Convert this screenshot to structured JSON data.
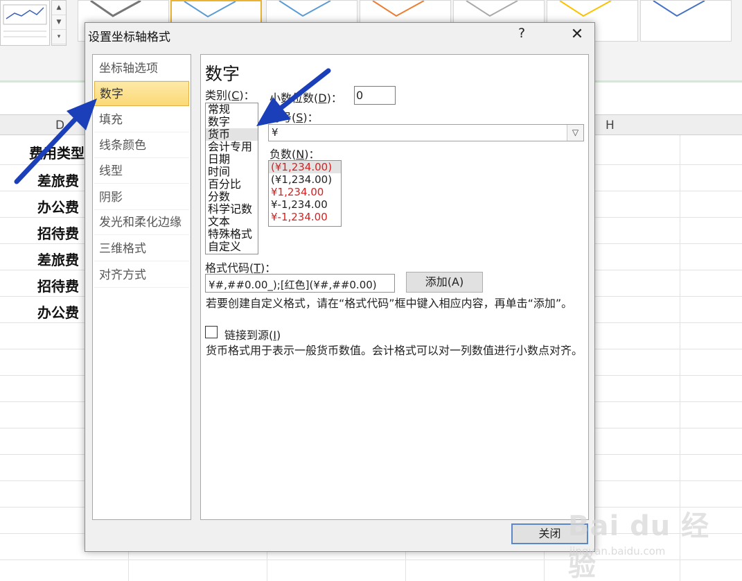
{
  "background": {
    "col_letters": [
      "D",
      "H"
    ],
    "cells": [
      "费用类型",
      "差旅费",
      "办公费",
      "招待费",
      "差旅费",
      "招待费",
      "办公费"
    ]
  },
  "dialog": {
    "title": "设置坐标轴格式",
    "help_glyph": "?",
    "close_glyph": "✕",
    "nav": [
      "坐标轴选项",
      "数字",
      "填充",
      "线条颜色",
      "线型",
      "阴影",
      "发光和柔化边缘",
      "三维格式",
      "对齐方式"
    ],
    "nav_selected": "数字",
    "panel_title": "数字",
    "category_label": "类别(",
    "category_key": "C",
    "category_suffix": ")：",
    "categories": [
      "常规",
      "数字",
      "货币",
      "会计专用",
      "日期",
      "时间",
      "百分比",
      "分数",
      "科学记数",
      "文本",
      "特殊格式",
      "自定义"
    ],
    "category_selected": "货币",
    "decimal_label": "小数位数(",
    "decimal_key": "D",
    "decimal_suffix": ")：",
    "decimal_value": "0",
    "symbol_label": "符号(",
    "symbol_key": "S",
    "symbol_suffix": ")：",
    "symbol_value": "¥",
    "negative_label": "负数(",
    "negative_key": "N",
    "negative_suffix": ")：",
    "negatives": [
      "(¥1,234.00)",
      "(¥1,234.00)",
      "¥1,234.00",
      "¥-1,234.00",
      "¥-1,234.00"
    ],
    "format_code_label": "格式代码(",
    "format_code_key": "T",
    "format_code_suffix": ")：",
    "format_code_value": "¥#,##0.00_);[红色](¥#,##0.00)",
    "add_button": "添加(A)",
    "hint": "若要创建自定义格式，请在“格式代码”框中键入相应内容，再单击“添加”。",
    "link_label": "链接到源(",
    "link_key": "I",
    "link_suffix": ")",
    "description": "货币格式用于表示一般货币数值。会计格式可以对一列数值进行小数点对齐。",
    "close_button": "关闭"
  },
  "watermark": {
    "text": "Bai du 经验",
    "url": "jingyan.baidu.com"
  },
  "colors": {
    "accent_arrow": "#1a3fb8",
    "negative_red": "#d81e1e",
    "nav_selected": "#fbd975"
  }
}
